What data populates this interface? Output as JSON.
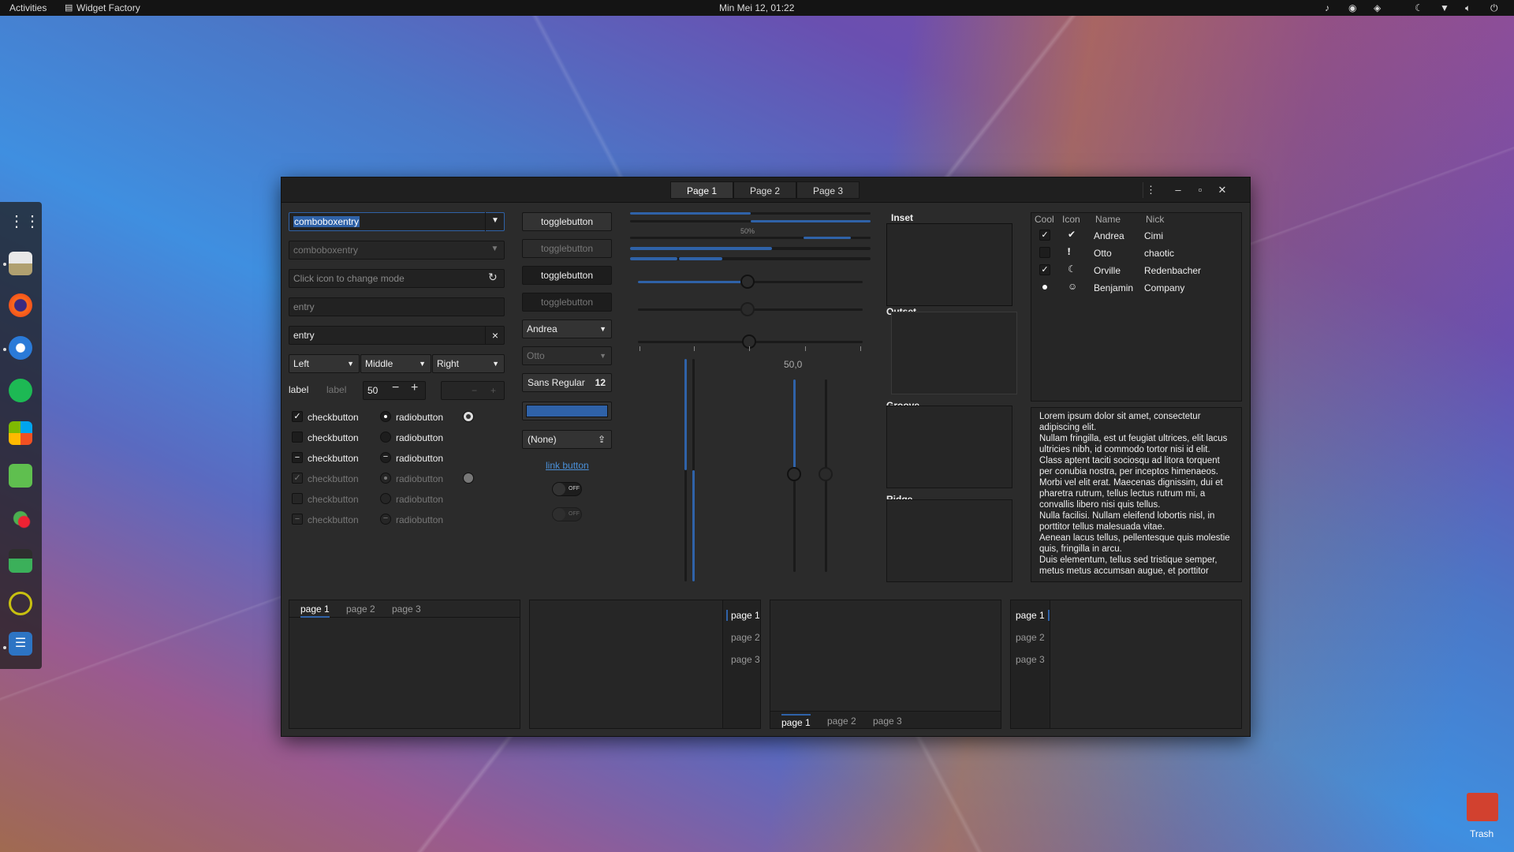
{
  "topbar": {
    "activities": "Activities",
    "app_name": "Widget Factory",
    "clock": "Min Mei 12, 01:22"
  },
  "desktop": {
    "trash_label": "Trash"
  },
  "header": {
    "tabs": [
      "Page 1",
      "Page 2",
      "Page 3"
    ],
    "active_tab": "Page 1",
    "minimize": "–",
    "maximize": "▫",
    "close": "✕",
    "menu": "⋮"
  },
  "col1": {
    "combo_entry_1": "comboboxentry",
    "combo_entry_2": "comboboxentry",
    "mode_entry_placeholder": "Click icon to change mode",
    "entry_placeholder": "entry",
    "entry_value": "entry",
    "align_combos": [
      "Left",
      "Middle",
      "Right"
    ],
    "label_1": "label",
    "label_2": "label",
    "spin_value": "50",
    "check_label": "checkbutton",
    "radio_label": "radiobutton"
  },
  "col2": {
    "toggle_label": "togglebutton",
    "combo_andrea": "Andrea",
    "combo_otto": "Otto",
    "font_name": "Sans Regular",
    "font_size": "12",
    "file_chooser": "(None)",
    "link_button": "link button",
    "switch_off": "OFF"
  },
  "col3": {
    "progress_text": "50%",
    "progress_value": 0.5,
    "scale_value_label": "50,0",
    "scale_value": 50
  },
  "frames": {
    "inset": "Inset",
    "outset": "Outset",
    "groove": "Groove",
    "ridge": "Ridge"
  },
  "tree": {
    "columns": [
      "Cool",
      "Icon",
      "Name",
      "Nick"
    ],
    "rows": [
      {
        "cool": "checked",
        "icon": "check-circle-icon",
        "name": "Andrea",
        "nick": "Cimi"
      },
      {
        "cool": "unchecked",
        "icon": "warning-icon",
        "name": "Otto",
        "nick": "chaotic"
      },
      {
        "cool": "checked",
        "icon": "moon-icon",
        "name": "Orville",
        "nick": "Redenbacher"
      },
      {
        "cool": "radio",
        "icon": "face-icon",
        "name": "Benjamin",
        "nick": "Company"
      }
    ]
  },
  "text_view": "Lorem ipsum dolor sit amet, consectetur adipiscing elit.\nNullam fringilla, est ut feugiat ultrices, elit lacus ultricies nibh, id commodo tortor nisi id elit.\nClass aptent taciti sociosqu ad litora torquent per conubia nostra, per inceptos himenaeos.\nMorbi vel elit erat. Maecenas dignissim, dui et pharetra rutrum, tellus lectus rutrum mi, a convallis libero nisi quis tellus.\nNulla facilisi. Nullam eleifend lobortis nisl, in porttitor tellus malesuada vitae.\nAenean lacus tellus, pellentesque quis molestie quis, fringilla in arcu.\nDuis elementum, tellus sed tristique semper, metus metus accumsan augue, et porttitor",
  "notebooks": {
    "tabs": [
      "page 1",
      "page 2",
      "page 3"
    ]
  }
}
